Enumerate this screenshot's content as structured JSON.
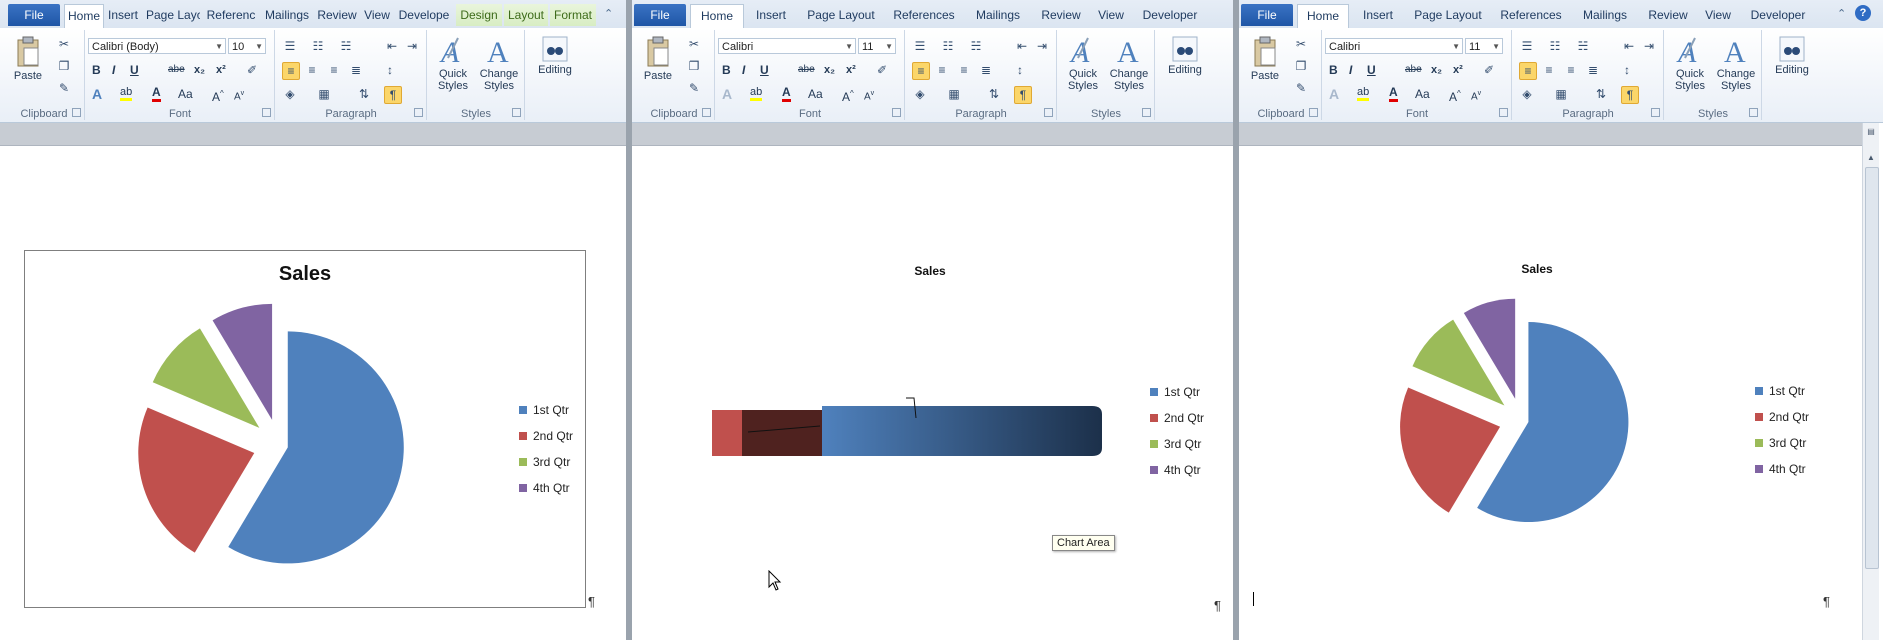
{
  "colors": {
    "q1": "#4f81bd",
    "q2": "#c0504d",
    "q3": "#9bbb59",
    "q4": "#8064a2",
    "file_tab": "#2a62b5"
  },
  "panels": [
    {
      "tabs": {
        "file": "File",
        "home": "Home",
        "insert": "Insert",
        "page_layout": "Page Layc",
        "references": "Referenc",
        "mailings": "Mailings",
        "review": "Review",
        "view": "View",
        "developer": "Develope",
        "design": "Design",
        "layout": "Layout",
        "format": "Format"
      },
      "font_name": "Calibri (Body)",
      "font_size": "10",
      "ribbon": {
        "paste": "Paste",
        "clipboard": "Clipboard",
        "font": "Font",
        "paragraph": "Paragraph",
        "styles": "Styles",
        "quick_styles": "Quick Styles",
        "change_styles": "Change Styles",
        "editing": "Editing"
      },
      "chart_title": "Sales",
      "legend": [
        "1st Qtr",
        "2nd Qtr",
        "3rd Qtr",
        "4th Qtr"
      ],
      "pilcrow": "¶"
    },
    {
      "tabs": {
        "file": "File",
        "home": "Home",
        "insert": "Insert",
        "page_layout": "Page Layout",
        "references": "References",
        "mailings": "Mailings",
        "review": "Review",
        "view": "View",
        "developer": "Developer"
      },
      "font_name": "Calibri",
      "font_size": "11",
      "ribbon": {
        "paste": "Paste",
        "clipboard": "Clipboard",
        "font": "Font",
        "paragraph": "Paragraph",
        "styles": "Styles",
        "quick_styles": "Quick Styles",
        "change_styles": "Change Styles",
        "editing": "Editing"
      },
      "chart_title": "Sales",
      "legend": [
        "1st Qtr",
        "2nd Qtr",
        "3rd Qtr",
        "4th Qtr"
      ],
      "tooltip": "Chart Area",
      "pilcrow": "¶"
    },
    {
      "tabs": {
        "file": "File",
        "home": "Home",
        "insert": "Insert",
        "page_layout": "Page Layout",
        "references": "References",
        "mailings": "Mailings",
        "review": "Review",
        "view": "View",
        "developer": "Developer"
      },
      "font_name": "Calibri",
      "font_size": "11",
      "ribbon": {
        "paste": "Paste",
        "clipboard": "Clipboard",
        "font": "Font",
        "paragraph": "Paragraph",
        "styles": "Styles",
        "quick_styles": "Quick Styles",
        "change_styles": "Change Styles",
        "editing": "Editing"
      },
      "chart_title": "Sales",
      "legend": [
        "1st Qtr",
        "2nd Qtr",
        "3rd Qtr",
        "4th Qtr"
      ],
      "pilcrow": "¶"
    }
  ],
  "chart_data": [
    {
      "type": "pie",
      "title": "Sales",
      "categories": [
        "1st Qtr",
        "2nd Qtr",
        "3rd Qtr",
        "4th Qtr"
      ],
      "values": [
        8.2,
        3.2,
        1.4,
        1.2
      ],
      "exploded": true,
      "legend": "right"
    },
    {
      "type": "pie",
      "title": "Sales",
      "categories": [
        "1st Qtr",
        "2nd Qtr",
        "3rd Qtr",
        "4th Qtr"
      ],
      "values": [
        8.2,
        3.2,
        1.4,
        1.2
      ],
      "style": "3d-edge-on",
      "legend": "right"
    },
    {
      "type": "pie",
      "title": "Sales",
      "categories": [
        "1st Qtr",
        "2nd Qtr",
        "3rd Qtr",
        "4th Qtr"
      ],
      "values": [
        8.2,
        3.2,
        1.4,
        1.2
      ],
      "exploded": true,
      "legend": "right"
    }
  ]
}
